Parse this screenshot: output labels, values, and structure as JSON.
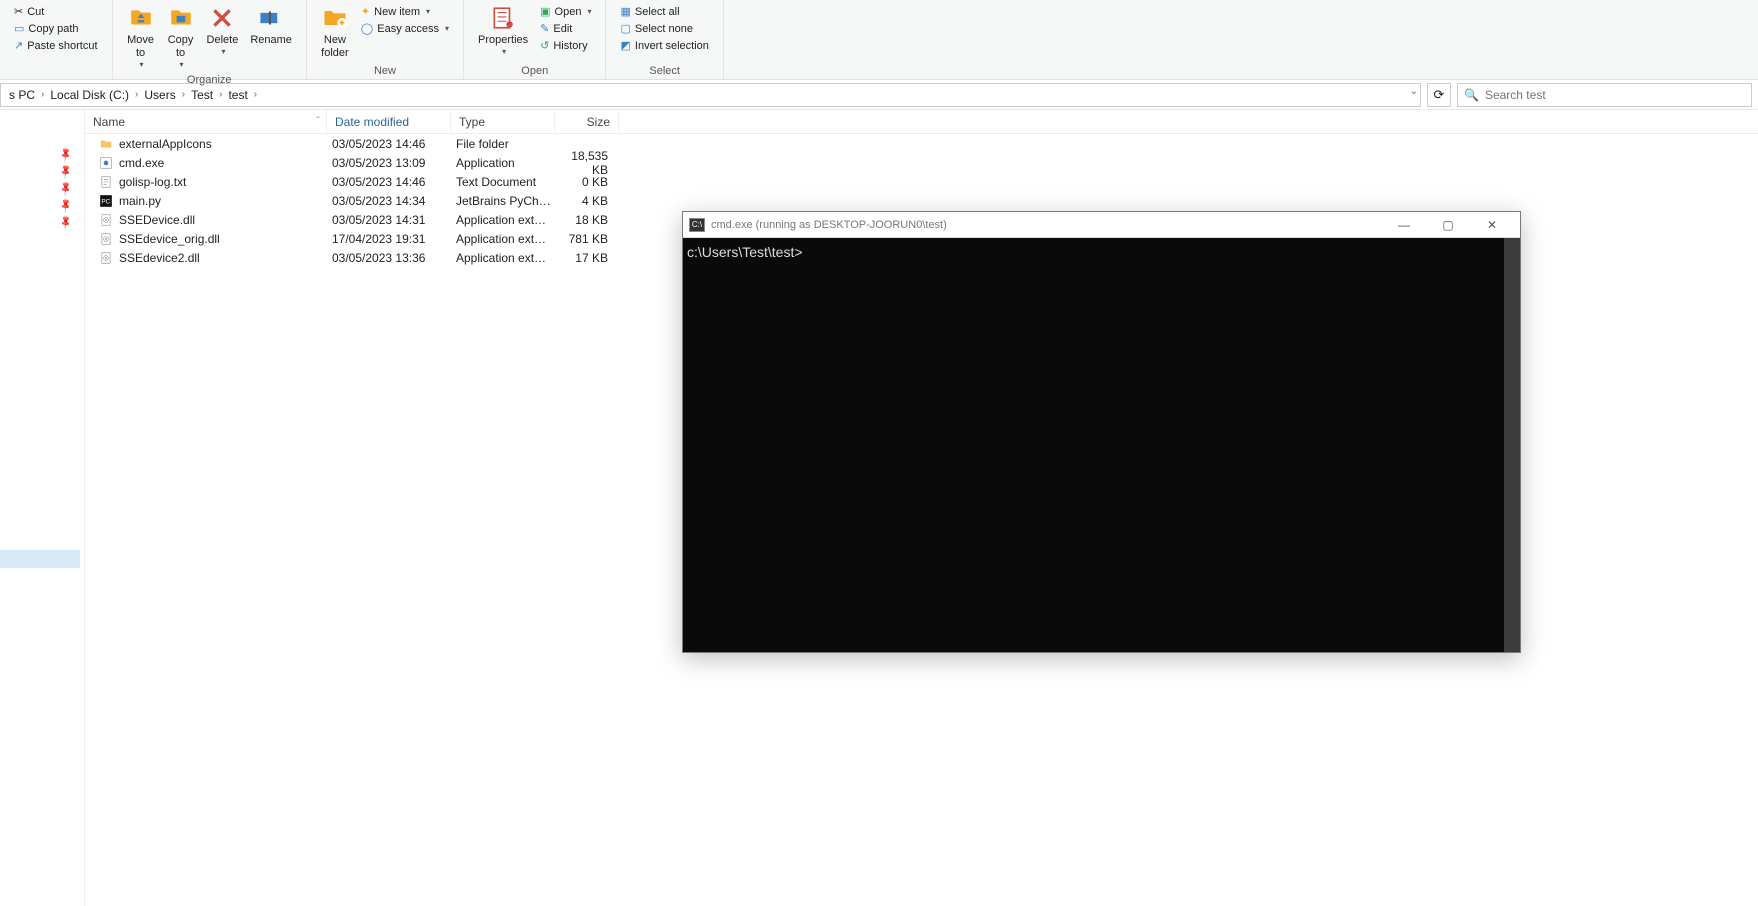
{
  "ribbon": {
    "clipboard": {
      "cut": "Cut",
      "copy_path": "Copy path",
      "paste_shortcut": "Paste shortcut"
    },
    "organize": {
      "move_to": "Move\nto",
      "copy_to": "Copy\nto",
      "delete": "Delete",
      "rename": "Rename",
      "title": "Organize"
    },
    "new": {
      "new_folder": "New\nfolder",
      "new_item": "New item",
      "easy_access": "Easy access",
      "title": "New"
    },
    "open": {
      "properties": "Properties",
      "open": "Open",
      "edit": "Edit",
      "history": "History",
      "title": "Open"
    },
    "select": {
      "select_all": "Select all",
      "select_none": "Select none",
      "invert": "Invert selection",
      "title": "Select"
    }
  },
  "breadcrumb": {
    "parts": [
      "s PC",
      "Local Disk (C:)",
      "Users",
      "Test",
      "test"
    ]
  },
  "search": {
    "placeholder": "Search test"
  },
  "columns": {
    "name": "Name",
    "date": "Date modified",
    "type": "Type",
    "size": "Size"
  },
  "files": [
    {
      "icon": "folder",
      "name": "externalAppIcons",
      "date": "03/05/2023 14:46",
      "type": "File folder",
      "size": ""
    },
    {
      "icon": "app",
      "name": "cmd.exe",
      "date": "03/05/2023 13:09",
      "type": "Application",
      "size": "18,535 KB"
    },
    {
      "icon": "txt",
      "name": "golisp-log.txt",
      "date": "03/05/2023 14:46",
      "type": "Text Document",
      "size": "0 KB"
    },
    {
      "icon": "pycharm",
      "name": "main.py",
      "date": "03/05/2023 14:34",
      "type": "JetBrains PyChar...",
      "size": "4 KB"
    },
    {
      "icon": "dll",
      "name": "SSEDevice.dll",
      "date": "03/05/2023 14:31",
      "type": "Application exten...",
      "size": "18 KB"
    },
    {
      "icon": "dll",
      "name": "SSEdevice_orig.dll",
      "date": "17/04/2023 19:31",
      "type": "Application exten...",
      "size": "781 KB"
    },
    {
      "icon": "dll",
      "name": "SSEdevice2.dll",
      "date": "03/05/2023 13:36",
      "type": "Application exten...",
      "size": "17 KB"
    }
  ],
  "cmd": {
    "title": "cmd.exe (running as DESKTOP-JOORUN0\\test)",
    "prompt": "c:\\Users\\Test\\test>"
  }
}
